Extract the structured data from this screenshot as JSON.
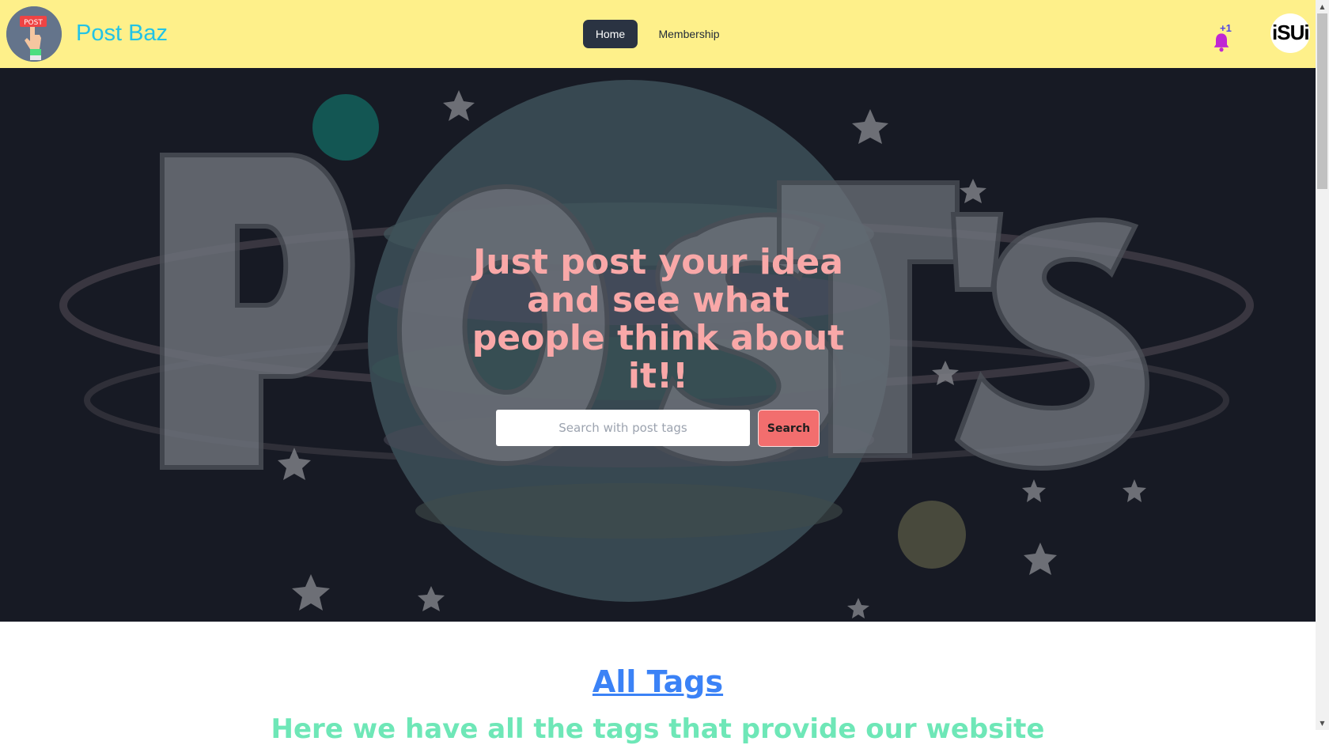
{
  "navbar": {
    "logo_text": "POST",
    "brand": "Post Baz",
    "nav_items": [
      "Home",
      "Membership"
    ],
    "active_item": "Home",
    "notification_badge": "+1",
    "avatar_text": "iSUi"
  },
  "hero": {
    "background_art_text": "POST'S",
    "headline": "Just post your idea and see what people think about it!!",
    "search": {
      "placeholder": "Search with post tags",
      "value": "",
      "button_label": "Search"
    }
  },
  "tags_section": {
    "title": "All Tags",
    "subtitle": "Here we have all the tags that provide our website"
  },
  "colors": {
    "navbar_bg": "#fef08a",
    "brand": "#22c3e6",
    "headline": "#f9a8a8",
    "search_button": "#f26e6e",
    "tags_title": "#3b82f6",
    "tags_subtitle": "#6ee7b7",
    "bell": "#c026d3"
  },
  "icons": {
    "logo": "hand-holding-post-sign",
    "notification": "bell-icon"
  }
}
